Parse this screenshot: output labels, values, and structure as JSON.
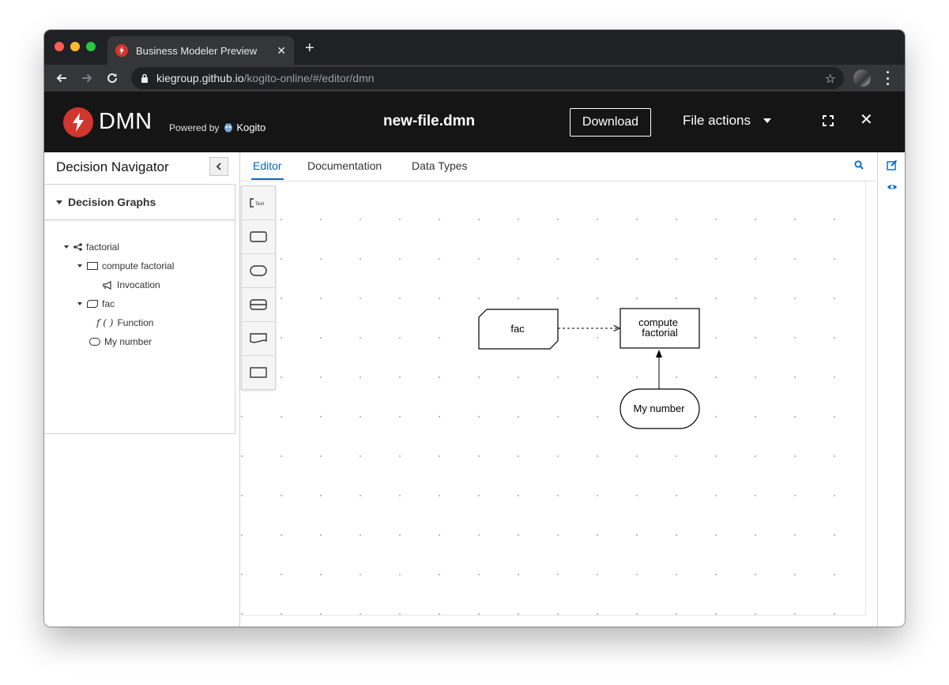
{
  "browser": {
    "tab_title": "Business Modeler Preview",
    "url_host": "kiegroup.github.io",
    "url_path": "/kogito-online/#/editor/dmn"
  },
  "header": {
    "logo_text": "DMN",
    "powered_by": "Powered by",
    "powered_brand": "Kogito",
    "filename": "new-file.dmn",
    "download_label": "Download",
    "file_actions_label": "File actions"
  },
  "navigator": {
    "title": "Decision Navigator",
    "section_label": "Decision Graphs",
    "tree": [
      {
        "label": "factorial",
        "icon": "share-icon"
      },
      {
        "label": "compute factorial",
        "icon": "decision-icon"
      },
      {
        "label": "Invocation",
        "icon": "invocation-icon"
      },
      {
        "label": "fac",
        "icon": "bkm-icon"
      },
      {
        "label": "Function",
        "icon": "function-icon",
        "prefix": "f ( )"
      },
      {
        "label": "My number",
        "icon": "input-data-icon"
      }
    ]
  },
  "editor": {
    "tabs": [
      "Editor",
      "Documentation",
      "Data Types"
    ],
    "active_tab": "Editor",
    "palette": [
      "text-annotation-icon",
      "decision-icon",
      "input-data-icon",
      "knowledge-source-icon",
      "knowledge-model-icon",
      "decision-service-icon"
    ],
    "diagram": {
      "nodes": [
        {
          "label": "fac",
          "type": "business-knowledge-model"
        },
        {
          "label": "compute factorial",
          "label_line1": "compute",
          "label_line2": "factorial",
          "type": "decision"
        },
        {
          "label": "My number",
          "type": "input-data"
        }
      ],
      "edges": [
        {
          "from": "fac",
          "to": "compute factorial",
          "style": "dashed"
        },
        {
          "from": "My number",
          "to": "compute factorial",
          "style": "solid"
        }
      ]
    }
  },
  "colors": {
    "accent": "#0066cc",
    "brand_red": "#d0362d",
    "header_bg": "#151515",
    "chrome_dark": "#202124"
  }
}
